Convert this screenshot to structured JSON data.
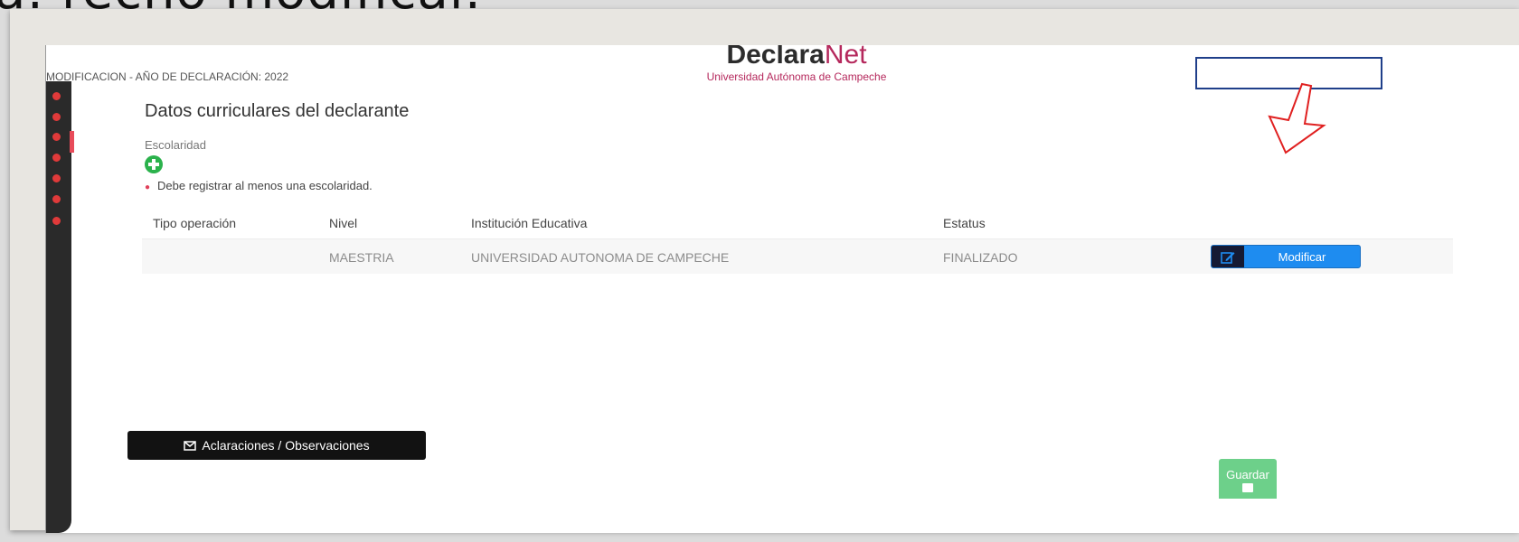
{
  "slide": {
    "heading_fragment": "a: recho modifical:"
  },
  "app": {
    "header_left": "MODIFICACION - AÑO DE DECLARACIÓN: 2022",
    "brand": {
      "part1": "Declara",
      "part2": "Net",
      "subtitle": "Universidad Autónoma de Campeche"
    }
  },
  "section": {
    "title": "Datos curriculares del declarante",
    "field_label": "Escolaridad",
    "warning": "Debe registrar al menos una escolaridad."
  },
  "table": {
    "headers": [
      "Tipo operación",
      "Nivel",
      "Institución Educativa",
      "Estatus"
    ],
    "rows": [
      {
        "tipo": "",
        "nivel": "MAESTRIA",
        "institucion": "UNIVERSIDAD AUTONOMA DE CAMPECHE",
        "estatus": "FINALIZADO",
        "action": "Modificar"
      }
    ]
  },
  "buttons": {
    "aclaraciones": "Aclaraciones / Observaciones",
    "guardar": "Guardar"
  },
  "colors": {
    "brand_accent": "#b5285c",
    "primary": "#1e8cf0",
    "success": "#6dd08a",
    "annotation": "#e02020"
  },
  "icons": {
    "add": "plus-circle-icon",
    "edit": "edit-icon",
    "mail": "envelope-icon",
    "save": "save-icon"
  }
}
